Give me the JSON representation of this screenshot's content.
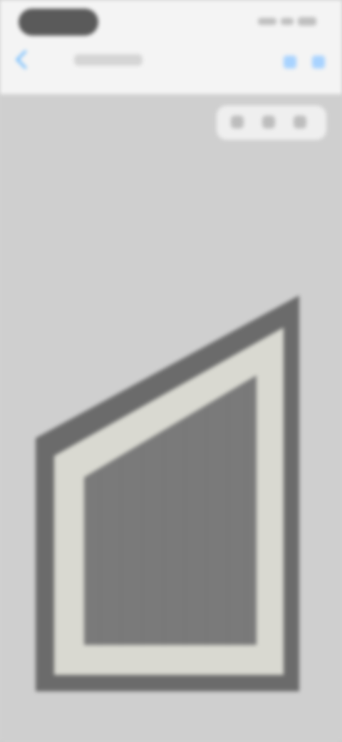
{
  "nav": {
    "back_label": ""
  },
  "icons": {
    "back": "chevron-left-icon",
    "action_1": "rotate-icon",
    "action_2": "more-icon"
  },
  "colors": {
    "accent": "#5fb4ff",
    "header_bg": "#f4f4f4",
    "content_bg": "#cfcfcf",
    "frame_outer": "#6b6b6b",
    "frame_mat": "#d9d9d1",
    "frame_inner": "#7a7a7a"
  }
}
